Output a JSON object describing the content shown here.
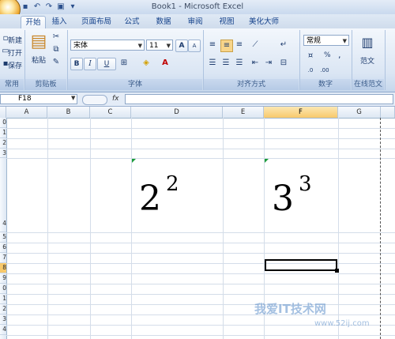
{
  "window": {
    "title": "Book1 - Microsoft Excel"
  },
  "tabs": [
    {
      "label": "开始",
      "active": true
    },
    {
      "label": "插入"
    },
    {
      "label": "页面布局"
    },
    {
      "label": "公式"
    },
    {
      "label": "数据"
    },
    {
      "label": "审阅"
    },
    {
      "label": "视图"
    },
    {
      "label": "美化大师"
    }
  ],
  "ribbon": {
    "clipboard": {
      "new": "新建",
      "open": "打开",
      "save": "保存",
      "paste": "粘贴",
      "group_label": "剪贴板",
      "common_label": "常用"
    },
    "font": {
      "name": "宋体",
      "size": "11",
      "bold": "B",
      "italic": "I",
      "underline": "U",
      "grow": "A",
      "shrink": "A",
      "group_label": "字体"
    },
    "alignment": {
      "group_label": "对齐方式"
    },
    "number": {
      "format": "常规",
      "percent": "%",
      "comma": ",",
      "group_label": "数字"
    },
    "template": {
      "label": "范文",
      "group_label": "在线范文"
    }
  },
  "formula_bar": {
    "name_box": "F18",
    "fx": "fx",
    "value": ""
  },
  "columns": [
    {
      "label": "A"
    },
    {
      "label": "B"
    },
    {
      "label": "C"
    },
    {
      "label": "D"
    },
    {
      "label": "E"
    },
    {
      "label": "F",
      "selected": true
    },
    {
      "label": "G"
    }
  ],
  "rows": [
    "0",
    "1",
    "2",
    "3",
    "4",
    "5",
    "6",
    "7",
    "8",
    "9",
    "0",
    "1",
    "2",
    "3",
    "4"
  ],
  "cells": {
    "d_base": "2",
    "d_exp": "2",
    "f_base": "3",
    "f_exp": "3"
  },
  "watermark": {
    "text": "我爱IT技术网",
    "url": "www.52ij.com"
  },
  "colors": {
    "selected_header": "#f8c96b",
    "accent": "#15428b"
  }
}
